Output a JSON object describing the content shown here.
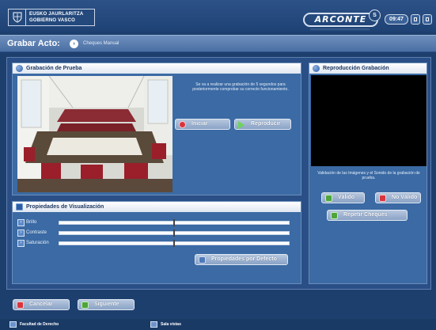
{
  "header": {
    "logo_lines": [
      "EUSKO JAURLARITZA",
      "GOBIERNO VASCO"
    ],
    "brand": "ARCONTE",
    "brand_sup": "S",
    "clock": "09:47"
  },
  "titlebar": {
    "title": "Grabar Acto:",
    "step_icon": "arrow-right-circle-icon",
    "breadcrumb": "Cheques Manual"
  },
  "test_recording": {
    "title": "Grabación de Prueba",
    "info": "Se va a realizar una grabación de 5 segundos para posteriormente comprobar su correcto funcionamiento.",
    "start_label": "Iniciar",
    "play_label": "Reproducir"
  },
  "playback": {
    "title": "Reproducción Grabación",
    "info": "Validación de las Imágenes y el Sonido de la grabación de prueba.",
    "valid_label": "Válido",
    "invalid_label": "No Válido",
    "repeat_label": "Repetir Cheques"
  },
  "display_props": {
    "title": "Propiedades de Visualización",
    "sliders": [
      {
        "label": "Brillo",
        "value": 0.5
      },
      {
        "label": "Contraste",
        "value": 0.5
      },
      {
        "label": "Saturación",
        "value": 0.5
      }
    ],
    "defaults_label": "Propiedades por Defecto"
  },
  "footer": {
    "cancel_label": "Cancelar",
    "next_label": "Siguiente"
  },
  "status": {
    "location": "Facultad de Derecho",
    "room": "Sala vistas"
  },
  "colors": {
    "background": "#1d3f6e",
    "panel": "#3b6aa4",
    "danger": "#d8353c",
    "success": "#4ea53b"
  }
}
